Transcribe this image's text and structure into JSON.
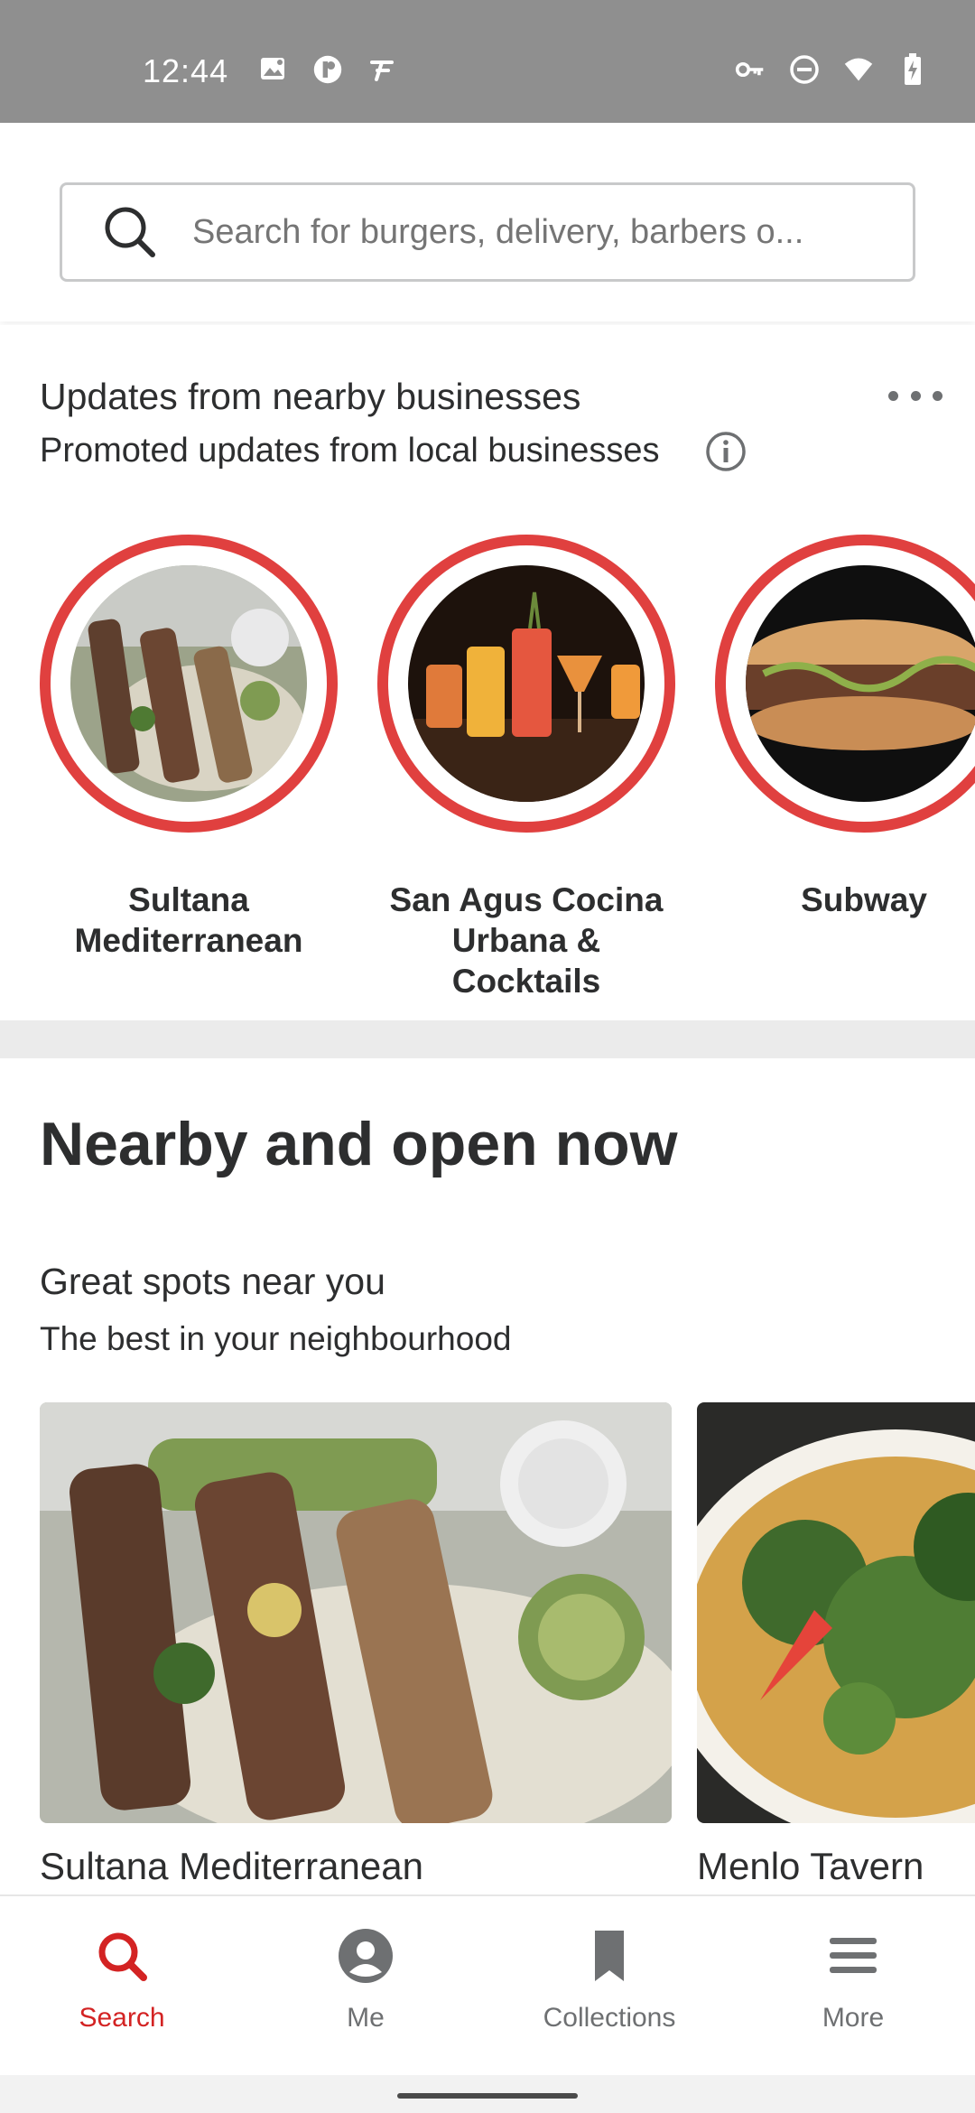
{
  "status_bar": {
    "time": "12:44",
    "left_icons": [
      "image-icon",
      "app-badge-icon",
      "font-app-icon"
    ],
    "right_icons": [
      "vpn-key-icon",
      "do-not-disturb-icon",
      "wifi-icon",
      "battery-charging-icon"
    ]
  },
  "search": {
    "placeholder": "Search for burgers, delivery, barbers o..."
  },
  "updates": {
    "title": "Updates from nearby businesses",
    "subtitle": "Promoted updates from local businesses",
    "stories": [
      {
        "name": "Sultana Mediterranean",
        "image": "kebab-plate-photo"
      },
      {
        "name": "San Agus Cocina Urbana & Cocktails",
        "image": "cocktails-photo"
      },
      {
        "name": "Subway",
        "image": "sandwich-photo"
      }
    ]
  },
  "nearby": {
    "title": "Nearby and open now",
    "section_title": "Great spots near you",
    "section_subtitle": "The best in your neighbourhood",
    "cards": [
      {
        "name": "Sultana Mediterranean",
        "image": "kebab-plate-photo"
      },
      {
        "name": "Menlo Tavern",
        "image": "salad-photo"
      }
    ]
  },
  "bottom_nav": {
    "items": [
      {
        "label": "Search",
        "icon": "search-icon",
        "active": true
      },
      {
        "label": "Me",
        "icon": "profile-icon",
        "active": false
      },
      {
        "label": "Collections",
        "icon": "bookmark-icon",
        "active": false
      },
      {
        "label": "More",
        "icon": "menu-icon",
        "active": false
      }
    ]
  },
  "colors": {
    "brand_red": "#d32323",
    "story_ring": "#e0403f",
    "status_bar": "#8f8f8f"
  }
}
